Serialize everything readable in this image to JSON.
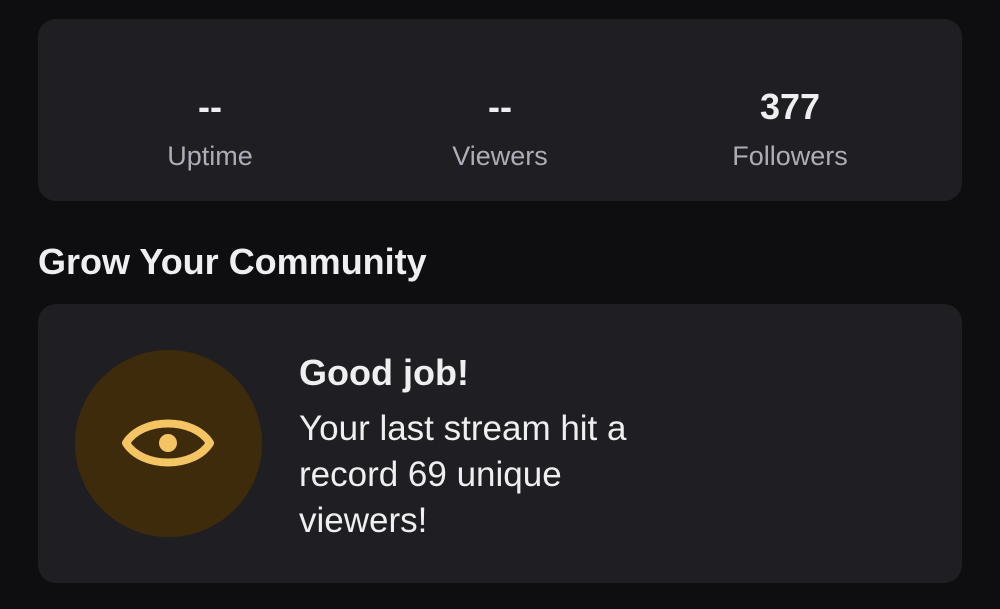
{
  "stats": [
    {
      "value": "--",
      "label": "Uptime"
    },
    {
      "value": "--",
      "label": "Viewers"
    },
    {
      "value": "377",
      "label": "Followers"
    }
  ],
  "section": {
    "heading": "Grow Your Community"
  },
  "achievement": {
    "icon": "eye-icon",
    "icon_color": "#f5c563",
    "badge_bg": "#3d2b0c",
    "title": "Good job!",
    "body": "Your last stream hit a record 69 unique viewers!"
  }
}
